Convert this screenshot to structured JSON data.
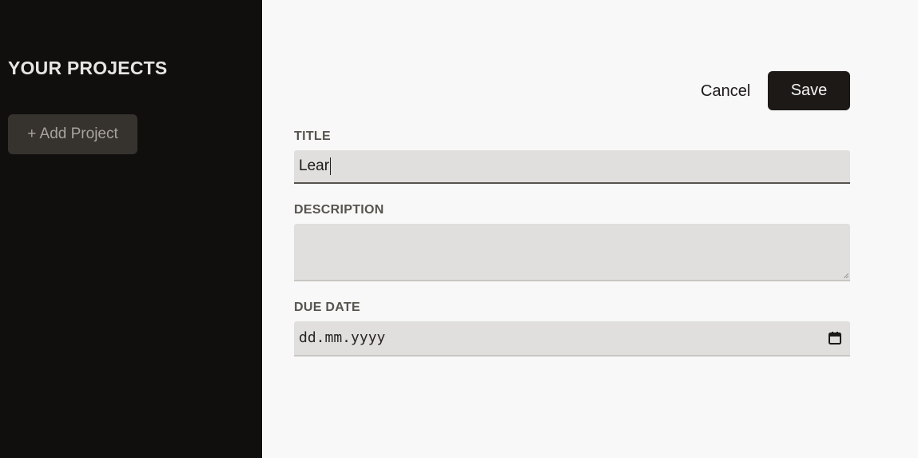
{
  "sidebar": {
    "title": "YOUR PROJECTS",
    "add_project_label": "+ Add Project"
  },
  "form": {
    "cancel_label": "Cancel",
    "save_label": "Save",
    "title_label": "TITLE",
    "title_value": "Lear",
    "description_label": "DESCRIPTION",
    "description_value": "",
    "due_date_label": "DUE DATE",
    "due_date_placeholder": "dd.mm.yyyy"
  },
  "icons": {
    "calendar": "calendar-icon",
    "resize": "resize-grip-icon"
  },
  "colors": {
    "sidebar_bg": "#110f0e",
    "main_bg": "#f8f8f8",
    "primary_button": "#1c1917",
    "input_bg": "#e0dfdd",
    "label_text": "#57534e"
  }
}
